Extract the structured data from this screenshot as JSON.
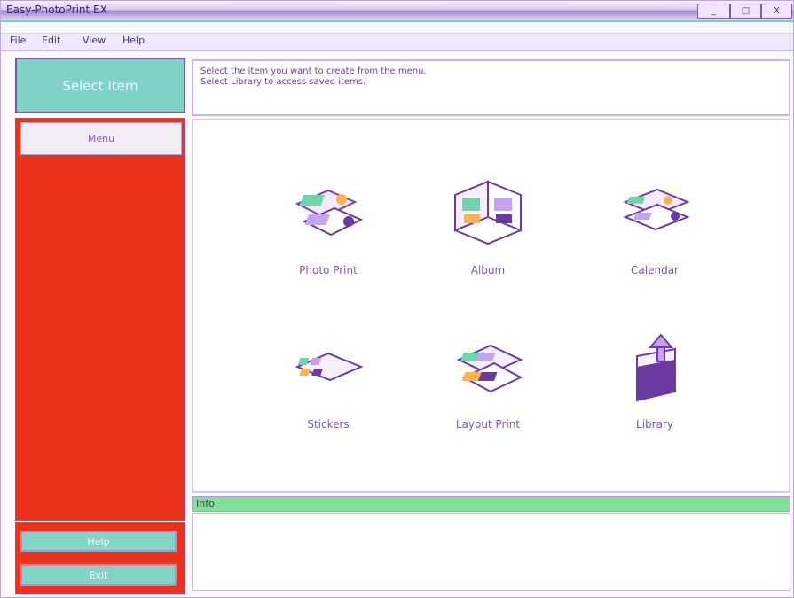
{
  "window": {
    "title": "Easy-PhotoPrint EX",
    "controls": {
      "minimize": "_",
      "maximize": "□",
      "close": "X"
    }
  },
  "menu": [
    "File",
    "Edit",
    "View",
    "Help"
  ],
  "left_panel": {
    "header": "Select Item",
    "items": [
      {
        "label": "Menu"
      }
    ],
    "buttons": {
      "help": "Help",
      "exit": "Exit"
    }
  },
  "instructions": {
    "line1": "Select the item you want to create from the menu.",
    "line2": "Select Library to access saved items."
  },
  "items": [
    {
      "label": "Photo Print",
      "icon": "photo-print-icon"
    },
    {
      "label": "Album",
      "icon": "album-icon"
    },
    {
      "label": "Calendar",
      "icon": "calendar-icon"
    },
    {
      "label": "Stickers",
      "icon": "stickers-icon"
    },
    {
      "label": "Layout Print",
      "icon": "layout-print-icon"
    },
    {
      "label": "Library",
      "icon": "library-icon"
    }
  ],
  "info": {
    "label": "Info"
  },
  "colors": {
    "accent_green": "#82df98",
    "accent_red": "#e9331c",
    "accent_teal": "#7fd2c8",
    "text_purple": "#7a5a9a"
  }
}
